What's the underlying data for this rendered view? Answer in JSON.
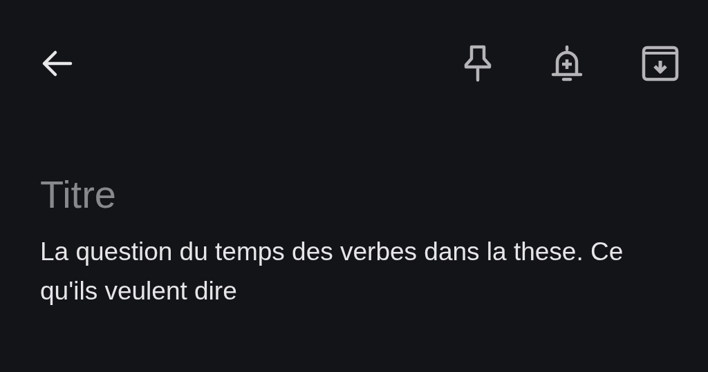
{
  "title_field": {
    "placeholder": "Titre"
  },
  "note_field": {
    "value": "La question du temps des verbes dans la these. Ce qu'ils veulent dire"
  }
}
